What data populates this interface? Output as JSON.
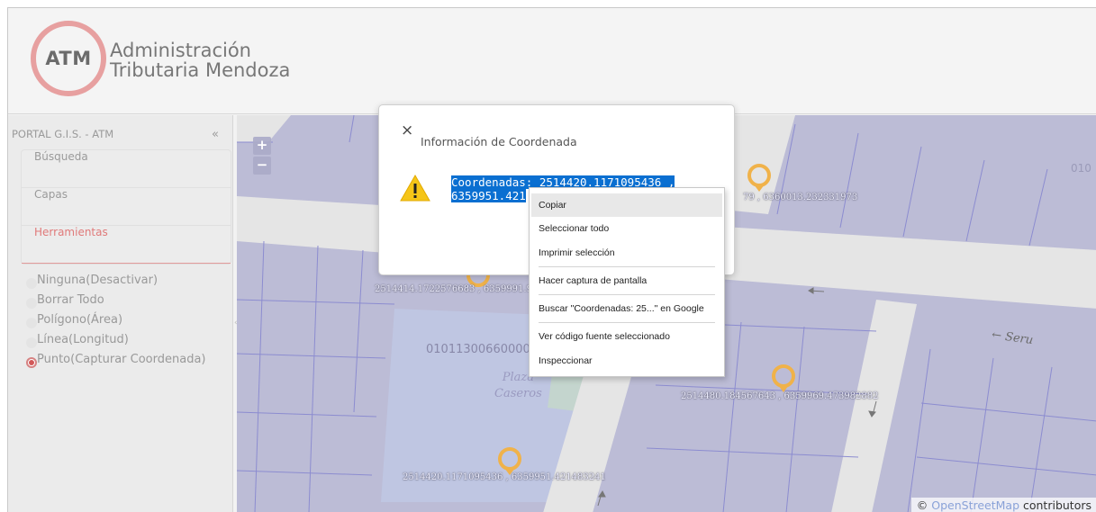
{
  "header": {
    "logo_abbr": "ATM",
    "logo_line1": "Administración",
    "logo_line2": "Tributaria Mendoza"
  },
  "sidebar": {
    "title": "PORTAL G.I.S. - ATM",
    "collapse_glyph": "«",
    "items": [
      {
        "label": "Búsqueda"
      },
      {
        "label": "Capas"
      },
      {
        "label": "Herramientas"
      }
    ],
    "tools": [
      {
        "label": "Ninguna(Desactivar)",
        "selected": false
      },
      {
        "label": "Borrar Todo",
        "selected": false
      },
      {
        "label": "Polígono(Área)",
        "selected": false
      },
      {
        "label": "Línea(Longitud)",
        "selected": false
      },
      {
        "label": "Punto(Capturar Coordenada)",
        "selected": true
      }
    ]
  },
  "map": {
    "zoom_in": "+",
    "zoom_out": "−",
    "markers": [
      {
        "label": "79 , 6360013.232331973"
      },
      {
        "label": "2514414.1722576683 , 6359991.9"
      },
      {
        "label": "2514480.184567643 , 6359969.473982882"
      },
      {
        "label": "2514420.1171095436 , 6359951.421483241"
      }
    ],
    "parcel_number": "01011300660000",
    "plaza_line1": "Plaza",
    "plaza_line2": "Caseros",
    "street_name": "Seru",
    "corner_number": "010",
    "attribution_prefix": "©",
    "attribution_link": "OpenStreetMap",
    "attribution_suffix": "contributors"
  },
  "modal": {
    "close_glyph": "×",
    "title": "Información de Coordenada",
    "coord_line1": "Coordenadas: 2514420.1171095436 ,",
    "coord_line2": "6359951.421"
  },
  "context_menu": {
    "items": [
      {
        "label": "Copiar"
      },
      {
        "label": "Seleccionar todo"
      },
      {
        "label": "Imprimir selección"
      },
      {
        "label": "Hacer captura de pantalla"
      },
      {
        "label": "Buscar \"Coordenadas: 25...\" en Google"
      },
      {
        "label": "Ver código fuente seleccionado"
      },
      {
        "label": "Inspeccionar"
      }
    ]
  },
  "colors": {
    "brand": "#e7a0a0",
    "active_menu": "#e07a7a",
    "selection": "#0a6fd1",
    "map_parcel": "#bcbcd6",
    "marker": "#f0b24a"
  }
}
